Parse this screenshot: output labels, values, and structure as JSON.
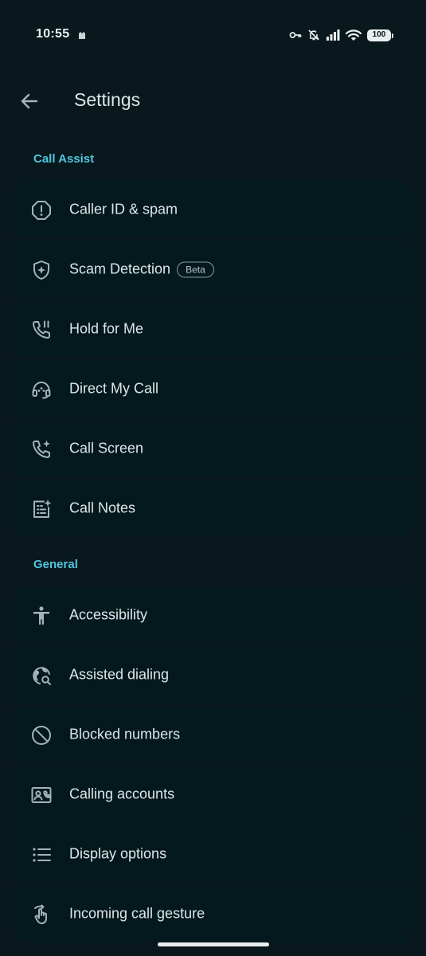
{
  "status_bar": {
    "time": "10:55",
    "battery": "100"
  },
  "header": {
    "title": "Settings"
  },
  "sections": {
    "call_assist": {
      "label": "Call Assist",
      "items": [
        {
          "label": "Caller ID & spam",
          "icon": "alert-circle-icon"
        },
        {
          "label": "Scam Detection",
          "icon": "shield-star-icon",
          "badge": "Beta"
        },
        {
          "label": "Hold for Me",
          "icon": "phone-pause-icon"
        },
        {
          "label": "Direct My Call",
          "icon": "headset-agent-icon"
        },
        {
          "label": "Call Screen",
          "icon": "phone-sparkle-icon"
        },
        {
          "label": "Call Notes",
          "icon": "notes-sparkle-icon"
        }
      ]
    },
    "general": {
      "label": "General",
      "items": [
        {
          "label": "Accessibility",
          "icon": "accessibility-icon"
        },
        {
          "label": "Assisted dialing",
          "icon": "globe-search-icon"
        },
        {
          "label": "Blocked numbers",
          "icon": "block-icon"
        },
        {
          "label": "Calling accounts",
          "icon": "contact-card-phone-icon"
        },
        {
          "label": "Display options",
          "icon": "list-icon"
        },
        {
          "label": "Incoming call gesture",
          "icon": "gesture-swipe-icon"
        }
      ]
    }
  },
  "colors": {
    "background": "#09181c",
    "row_background": "#04191d",
    "accent": "#4fc6e0",
    "text": "#dce6e8",
    "icon": "#a3b4b8"
  }
}
